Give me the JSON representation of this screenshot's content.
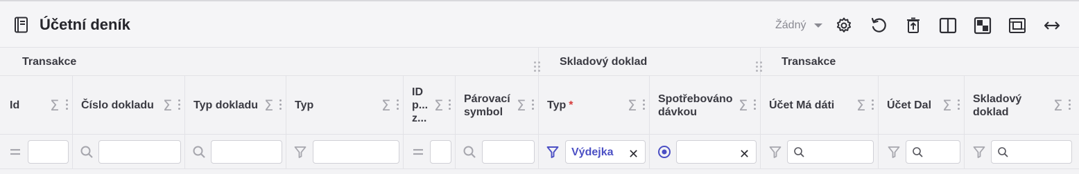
{
  "window": {
    "title": "Účetní deník",
    "saved_filter": "Žádný"
  },
  "toolbar": {
    "icons": [
      "settings-icon",
      "reset-icon",
      "export-icon",
      "split-view-icon",
      "pattern-icon",
      "fit-icon",
      "expand-width-icon"
    ]
  },
  "groups": [
    {
      "label": "Transakce"
    },
    {
      "label": "Skladový doklad"
    },
    {
      "label": "Transakce"
    }
  ],
  "columns": [
    {
      "label": "Id",
      "filter_icon": "equals-icon",
      "filter_value": ""
    },
    {
      "label": "Číslo dokladu",
      "filter_icon": "search-icon",
      "filter_value": ""
    },
    {
      "label": "Typ dokladu",
      "filter_icon": "search-icon",
      "filter_value": ""
    },
    {
      "label": "Typ",
      "filter_icon": "funnel-icon",
      "filter_value": ""
    },
    {
      "label": "ID p... z...",
      "filter_icon": "equals-icon",
      "filter_value": ""
    },
    {
      "label": "Párovací symbol",
      "filter_icon": "search-icon",
      "filter_value": ""
    },
    {
      "label": "Typ",
      "required_mark": "*",
      "filter_icon": "funnel-icon",
      "filter_value": "Výdejka"
    },
    {
      "label": "Spotřebováno dávkou",
      "filter_icon": "radio-icon",
      "filter_value": ""
    },
    {
      "label": "Účet Má dáti",
      "filter_icon": "funnel-icon",
      "filter_value": ""
    },
    {
      "label": "Účet Dal",
      "filter_icon": "funnel-icon",
      "filter_value": ""
    },
    {
      "label": "Skladový doklad",
      "filter_icon": "funnel-icon",
      "filter_value": ""
    }
  ],
  "colors": {
    "accent": "#4b4fc4",
    "required": "#d63b3b",
    "muted": "#a6a6ad"
  }
}
